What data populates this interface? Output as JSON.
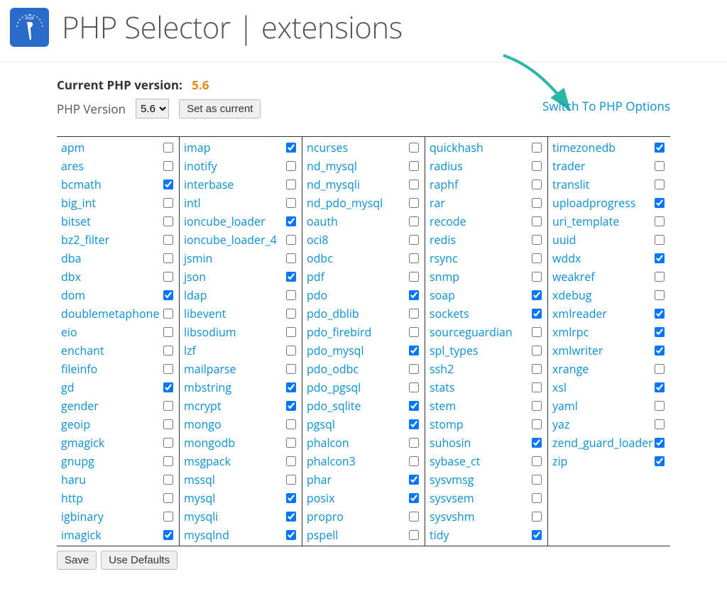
{
  "header": {
    "title": "PHP Selector | extensions"
  },
  "current_version": {
    "label": "Current PHP version:",
    "value": "5.6"
  },
  "selector": {
    "label": "PHP Version",
    "selected": "5.6",
    "button": "Set as current"
  },
  "switch_link": "Switch To PHP Options",
  "buttons": {
    "save": "Save",
    "defaults": "Use Defaults"
  },
  "columns": [
    [
      {
        "name": "apm",
        "checked": false
      },
      {
        "name": "ares",
        "checked": false
      },
      {
        "name": "bcmath",
        "checked": true
      },
      {
        "name": "big_int",
        "checked": false
      },
      {
        "name": "bitset",
        "checked": false
      },
      {
        "name": "bz2_filter",
        "checked": false
      },
      {
        "name": "dba",
        "checked": false
      },
      {
        "name": "dbx",
        "checked": false
      },
      {
        "name": "dom",
        "checked": true
      },
      {
        "name": "doublemetaphone",
        "checked": false
      },
      {
        "name": "eio",
        "checked": false
      },
      {
        "name": "enchant",
        "checked": false
      },
      {
        "name": "fileinfo",
        "checked": false
      },
      {
        "name": "gd",
        "checked": true
      },
      {
        "name": "gender",
        "checked": false
      },
      {
        "name": "geoip",
        "checked": false
      },
      {
        "name": "gmagick",
        "checked": false
      },
      {
        "name": "gnupg",
        "checked": false
      },
      {
        "name": "haru",
        "checked": false
      },
      {
        "name": "http",
        "checked": false
      },
      {
        "name": "igbinary",
        "checked": false
      },
      {
        "name": "imagick",
        "checked": true
      }
    ],
    [
      {
        "name": "imap",
        "checked": true
      },
      {
        "name": "inotify",
        "checked": false
      },
      {
        "name": "interbase",
        "checked": false
      },
      {
        "name": "intl",
        "checked": false
      },
      {
        "name": "ioncube_loader",
        "checked": true
      },
      {
        "name": "ioncube_loader_4",
        "checked": false
      },
      {
        "name": "jsmin",
        "checked": false
      },
      {
        "name": "json",
        "checked": true
      },
      {
        "name": "ldap",
        "checked": false
      },
      {
        "name": "libevent",
        "checked": false
      },
      {
        "name": "libsodium",
        "checked": false
      },
      {
        "name": "lzf",
        "checked": false
      },
      {
        "name": "mailparse",
        "checked": false
      },
      {
        "name": "mbstring",
        "checked": true
      },
      {
        "name": "mcrypt",
        "checked": true
      },
      {
        "name": "mongo",
        "checked": false
      },
      {
        "name": "mongodb",
        "checked": false
      },
      {
        "name": "msgpack",
        "checked": false
      },
      {
        "name": "mssql",
        "checked": false
      },
      {
        "name": "mysql",
        "checked": true
      },
      {
        "name": "mysqli",
        "checked": true
      },
      {
        "name": "mysqlnd",
        "checked": true
      }
    ],
    [
      {
        "name": "ncurses",
        "checked": false
      },
      {
        "name": "nd_mysql",
        "checked": false
      },
      {
        "name": "nd_mysqli",
        "checked": false
      },
      {
        "name": "nd_pdo_mysql",
        "checked": false
      },
      {
        "name": "oauth",
        "checked": false
      },
      {
        "name": "oci8",
        "checked": false
      },
      {
        "name": "odbc",
        "checked": false
      },
      {
        "name": "pdf",
        "checked": false
      },
      {
        "name": "pdo",
        "checked": true
      },
      {
        "name": "pdo_dblib",
        "checked": false
      },
      {
        "name": "pdo_firebird",
        "checked": false
      },
      {
        "name": "pdo_mysql",
        "checked": true
      },
      {
        "name": "pdo_odbc",
        "checked": false
      },
      {
        "name": "pdo_pgsql",
        "checked": false
      },
      {
        "name": "pdo_sqlite",
        "checked": true
      },
      {
        "name": "pgsql",
        "checked": true
      },
      {
        "name": "phalcon",
        "checked": false
      },
      {
        "name": "phalcon3",
        "checked": false
      },
      {
        "name": "phar",
        "checked": true
      },
      {
        "name": "posix",
        "checked": true
      },
      {
        "name": "propro",
        "checked": false
      },
      {
        "name": "pspell",
        "checked": false
      }
    ],
    [
      {
        "name": "quickhash",
        "checked": false
      },
      {
        "name": "radius",
        "checked": false
      },
      {
        "name": "raphf",
        "checked": false
      },
      {
        "name": "rar",
        "checked": false
      },
      {
        "name": "recode",
        "checked": false
      },
      {
        "name": "redis",
        "checked": false
      },
      {
        "name": "rsync",
        "checked": false
      },
      {
        "name": "snmp",
        "checked": false
      },
      {
        "name": "soap",
        "checked": true
      },
      {
        "name": "sockets",
        "checked": true
      },
      {
        "name": "sourceguardian",
        "checked": false
      },
      {
        "name": "spl_types",
        "checked": false
      },
      {
        "name": "ssh2",
        "checked": false
      },
      {
        "name": "stats",
        "checked": false
      },
      {
        "name": "stem",
        "checked": false
      },
      {
        "name": "stomp",
        "checked": false
      },
      {
        "name": "suhosin",
        "checked": true
      },
      {
        "name": "sybase_ct",
        "checked": false
      },
      {
        "name": "sysvmsg",
        "checked": false
      },
      {
        "name": "sysvsem",
        "checked": false
      },
      {
        "name": "sysvshm",
        "checked": false
      },
      {
        "name": "tidy",
        "checked": true
      }
    ],
    [
      {
        "name": "timezonedb",
        "checked": true
      },
      {
        "name": "trader",
        "checked": false
      },
      {
        "name": "translit",
        "checked": false
      },
      {
        "name": "uploadprogress",
        "checked": true
      },
      {
        "name": "uri_template",
        "checked": false
      },
      {
        "name": "uuid",
        "checked": false
      },
      {
        "name": "wddx",
        "checked": true
      },
      {
        "name": "weakref",
        "checked": false
      },
      {
        "name": "xdebug",
        "checked": false
      },
      {
        "name": "xmlreader",
        "checked": true
      },
      {
        "name": "xmlrpc",
        "checked": true
      },
      {
        "name": "xmlwriter",
        "checked": true
      },
      {
        "name": "xrange",
        "checked": false
      },
      {
        "name": "xsl",
        "checked": true
      },
      {
        "name": "yaml",
        "checked": false
      },
      {
        "name": "yaz",
        "checked": false
      },
      {
        "name": "zend_guard_loader",
        "checked": true
      },
      {
        "name": "zip",
        "checked": true
      }
    ]
  ]
}
